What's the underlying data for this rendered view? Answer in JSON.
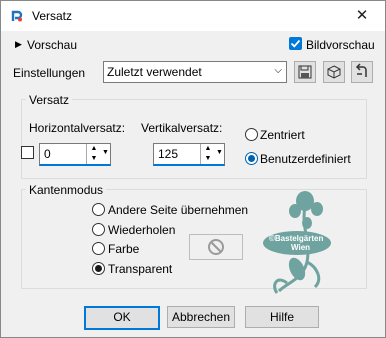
{
  "window": {
    "title": "Versatz",
    "close_glyph": "✕"
  },
  "preview": {
    "label": "Vorschau",
    "checkbox_label": "Bildvorschau",
    "checked": true
  },
  "settings": {
    "label": "Einstellungen",
    "selected": "Zuletzt verwendet"
  },
  "offset": {
    "group_title": "Versatz",
    "horizontal_label": "Horizontalversatz:",
    "horizontal_value": "0",
    "vertical_label": "Vertikalversatz:",
    "vertical_value": "125",
    "options": [
      {
        "label": "Zentriert",
        "selected": false
      },
      {
        "label": "Benutzerdefiniert",
        "selected": true
      }
    ]
  },
  "edge_mode": {
    "group_title": "Kantenmodus",
    "options": [
      {
        "label": "Andere Seite übernehmen",
        "selected": false
      },
      {
        "label": "Wiederholen",
        "selected": false
      },
      {
        "label": "Farbe",
        "selected": false
      },
      {
        "label": "Transparent",
        "selected": true
      }
    ]
  },
  "watermark": {
    "line1": "©Bastelgärten",
    "line2": "Wien"
  },
  "buttons": {
    "ok": "OK",
    "cancel": "Abbrechen",
    "help": "Hilfe"
  },
  "colors": {
    "accent": "#0078d7",
    "title_bg": "#ffffff",
    "dialog_bg": "#f0f0f0",
    "watermark": "#6fa39f"
  }
}
